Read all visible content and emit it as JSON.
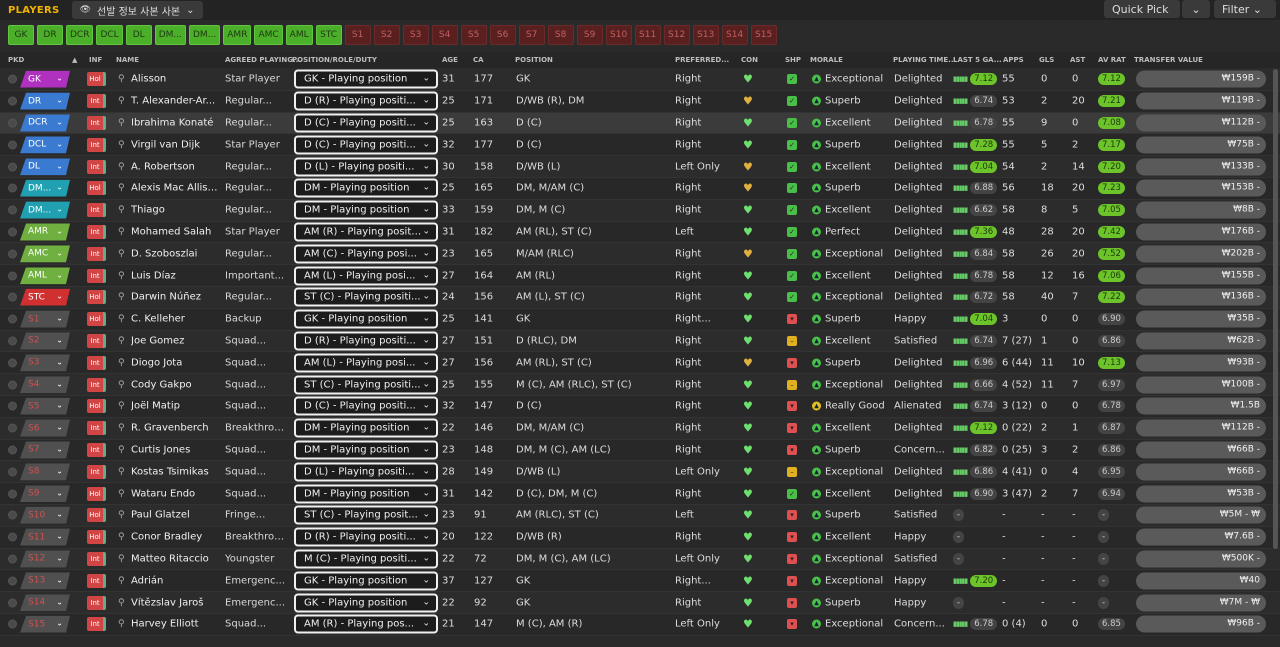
{
  "app": {
    "title": "PLAYERS",
    "view": "선발 정보 사본 사본",
    "quick_pick": "Quick Pick",
    "filter": "Filter"
  },
  "position_chips": {
    "filled": [
      "GK",
      "DR",
      "DCR",
      "DCL",
      "DL",
      "DM...",
      "DM...",
      "AMR",
      "AMC",
      "AML",
      "STC"
    ],
    "empty": [
      "S1",
      "S2",
      "S3",
      "S4",
      "S5",
      "S6",
      "S7",
      "S8",
      "S9",
      "S10",
      "S11",
      "S12",
      "S13",
      "S14",
      "S15"
    ]
  },
  "columns": {
    "pkd": "PKD",
    "sort": "▲",
    "inf": "INF",
    "name": "NAME",
    "status": "AGREED PLAYING...",
    "role": "POSITION/ROLE/DUTY",
    "age": "AGE",
    "ca": "CA",
    "position": "POSITION",
    "foot": "PREFERRED...",
    "con": "CON",
    "shp": "SHP",
    "morale": "MORALE",
    "ptime": "PLAYING TIME...",
    "last5": "LAST 5 GA...",
    "apps": "APPS",
    "gls": "GLS",
    "ast": "AST",
    "avrat": "AV RAT",
    "value": "TRANSFER VALUE"
  },
  "colors": {
    "accent": "#f0b400",
    "chip_green": "#4caf2a",
    "inf_red": "#d24545",
    "rating_green": "#6cc32a"
  },
  "players": [
    {
      "slot": "GK",
      "slot_color": "#b030c0",
      "inf": "Hol",
      "name": "Alisson",
      "status": "Star Player",
      "role": "GK - Playing position",
      "age": "31",
      "ca": "177",
      "pos": "GK",
      "foot": "Right",
      "con": "heart",
      "shp": "g",
      "morale": "Exceptional",
      "ptime": "Delighted",
      "last5": "7.12",
      "last5hi": true,
      "apps": "55",
      "gls": "0",
      "ast": "0",
      "avrat": "7.12",
      "avhi": true,
      "value": "₩159B - "
    },
    {
      "slot": "DR",
      "slot_color": "#3a7ad0",
      "inf": "Int",
      "name": "T. Alexander-Ar...",
      "status": "Regular...",
      "role": "D (R) - Playing positi...",
      "age": "25",
      "ca": "171",
      "pos": "D/WB (R), DM",
      "foot": "Right",
      "con": "gold",
      "shp": "g",
      "morale": "Superb",
      "ptime": "Delighted",
      "last5": "6.74",
      "last5hi": false,
      "apps": "53",
      "gls": "2",
      "ast": "20",
      "avrat": "7.21",
      "avhi": true,
      "value": "₩119B - "
    },
    {
      "slot": "DCR",
      "slot_color": "#3a7ad0",
      "inf": "Int",
      "name": "Ibrahima Konaté",
      "status": "Regular...",
      "role": "D (C) - Playing positi...",
      "age": "25",
      "ca": "163",
      "pos": "D (C)",
      "foot": "Right",
      "con": "heart",
      "shp": "g",
      "morale": "Excellent",
      "ptime": "Delighted",
      "last5": "6.78",
      "last5hi": false,
      "apps": "55",
      "gls": "9",
      "ast": "0",
      "avrat": "7.08",
      "avhi": true,
      "value": "₩112B - "
    },
    {
      "slot": "DCL",
      "slot_color": "#3a7ad0",
      "inf": "Int",
      "name": "Virgil van Dijk",
      "status": "Star Player",
      "role": "D (C) - Playing positi...",
      "age": "32",
      "ca": "177",
      "pos": "D (C)",
      "foot": "Right",
      "con": "heart",
      "shp": "g",
      "morale": "Superb",
      "ptime": "Delighted",
      "last5": "7.28",
      "last5hi": true,
      "apps": "55",
      "gls": "5",
      "ast": "2",
      "avrat": "7.17",
      "avhi": true,
      "value": "₩75B - "
    },
    {
      "slot": "DL",
      "slot_color": "#3a7ad0",
      "inf": "Int",
      "name": "A. Robertson",
      "status": "Regular...",
      "role": "D (L) - Playing positi...",
      "age": "30",
      "ca": "158",
      "pos": "D/WB (L)",
      "foot": "Left Only",
      "con": "gold",
      "shp": "g",
      "morale": "Excellent",
      "ptime": "Delighted",
      "last5": "7.04",
      "last5hi": true,
      "apps": "54",
      "gls": "2",
      "ast": "14",
      "avrat": "7.20",
      "avhi": true,
      "value": "₩133B - "
    },
    {
      "slot": "DM...",
      "slot_color": "#20a0b0",
      "inf": "Hol",
      "name": "Alexis Mac Allister",
      "status": "Regular...",
      "role": "DM - Playing position",
      "age": "25",
      "ca": "165",
      "pos": "DM, M/AM (C)",
      "foot": "Right",
      "con": "gold",
      "shp": "g",
      "morale": "Superb",
      "ptime": "Delighted",
      "last5": "6.88",
      "last5hi": false,
      "apps": "56",
      "gls": "18",
      "ast": "20",
      "avrat": "7.23",
      "avhi": true,
      "value": "₩153B - "
    },
    {
      "slot": "DM...",
      "slot_color": "#20a0b0",
      "inf": "Int",
      "name": "Thiago",
      "status": "Regular...",
      "role": "DM - Playing position",
      "age": "33",
      "ca": "159",
      "pos": "DM, M (C)",
      "foot": "Right",
      "con": "heart",
      "shp": "g",
      "morale": "Excellent",
      "ptime": "Delighted",
      "last5": "6.62",
      "last5hi": false,
      "apps": "58",
      "gls": "8",
      "ast": "5",
      "avrat": "7.05",
      "avhi": true,
      "value": "₩8B - "
    },
    {
      "slot": "AMR",
      "slot_color": "#70b040",
      "inf": "Int",
      "name": "Mohamed Salah",
      "status": "Star Player",
      "role": "AM (R) - Playing positi...",
      "age": "31",
      "ca": "182",
      "pos": "AM (RL), ST (C)",
      "foot": "Left",
      "con": "heart",
      "shp": "g",
      "morale": "Perfect",
      "ptime": "Delighted",
      "last5": "7.36",
      "last5hi": true,
      "apps": "48",
      "gls": "28",
      "ast": "20",
      "avrat": "7.42",
      "avhi": true,
      "value": "₩176B - "
    },
    {
      "slot": "AMC",
      "slot_color": "#70b040",
      "inf": "Int",
      "name": "D. Szoboszlai",
      "status": "Regular...",
      "role": "AM (C) - Playing posi...",
      "age": "23",
      "ca": "165",
      "pos": "M/AM (RLC)",
      "foot": "Right",
      "con": "gold",
      "shp": "g",
      "morale": "Exceptional",
      "ptime": "Delighted",
      "last5": "6.84",
      "last5hi": false,
      "apps": "58",
      "gls": "26",
      "ast": "20",
      "avrat": "7.52",
      "avhi": true,
      "value": "₩202B - "
    },
    {
      "slot": "AML",
      "slot_color": "#70b040",
      "inf": "Int",
      "name": "Luis Díaz",
      "status": "Important...",
      "role": "AM (L) - Playing posi...",
      "age": "27",
      "ca": "164",
      "pos": "AM (RL)",
      "foot": "Right",
      "con": "heart",
      "shp": "g",
      "morale": "Excellent",
      "ptime": "Delighted",
      "last5": "6.78",
      "last5hi": false,
      "apps": "58",
      "gls": "12",
      "ast": "16",
      "avrat": "7.06",
      "avhi": true,
      "value": "₩155B - "
    },
    {
      "slot": "STC",
      "slot_color": "#d03030",
      "inf": "Hol",
      "name": "Darwin Núñez",
      "status": "Regular...",
      "role": "ST (C) - Playing positi...",
      "age": "24",
      "ca": "156",
      "pos": "AM (L), ST (C)",
      "foot": "Right",
      "con": "heart",
      "shp": "g",
      "morale": "Exceptional",
      "ptime": "Delighted",
      "last5": "6.72",
      "last5hi": false,
      "apps": "58",
      "gls": "40",
      "ast": "7",
      "avrat": "7.22",
      "avhi": true,
      "value": "₩136B - "
    },
    {
      "slot": "S1",
      "slot_color": "res",
      "inf": "Hol",
      "name": "C. Kelleher",
      "status": "Backup",
      "role": "GK - Playing position",
      "age": "25",
      "ca": "141",
      "pos": "GK",
      "foot": "Right...",
      "con": "heart",
      "shp": "r",
      "morale": "Superb",
      "ptime": "Happy",
      "last5": "7.04",
      "last5hi": true,
      "apps": "3",
      "gls": "0",
      "ast": "0",
      "avrat": "6.90",
      "avhi": false,
      "value": "₩35B - "
    },
    {
      "slot": "S2",
      "slot_color": "res",
      "inf": "Int",
      "name": "Joe Gomez",
      "status": "Squad...",
      "role": "D (R) - Playing positi...",
      "age": "27",
      "ca": "151",
      "pos": "D (RLC), DM",
      "foot": "Right",
      "con": "heart",
      "shp": "y",
      "morale": "Excellent",
      "ptime": "Satisfied",
      "last5": "6.74",
      "last5hi": false,
      "apps": "7 (27)",
      "gls": "1",
      "ast": "0",
      "avrat": "6.86",
      "avhi": false,
      "value": "₩62B - "
    },
    {
      "slot": "S3",
      "slot_color": "res",
      "inf": "Int",
      "name": "Diogo Jota",
      "status": "Squad...",
      "role": "AM (L) - Playing posi...",
      "age": "27",
      "ca": "156",
      "pos": "AM (RL), ST (C)",
      "foot": "Right",
      "con": "gold",
      "shp": "r",
      "morale": "Superb",
      "ptime": "Delighted",
      "last5": "6.96",
      "last5hi": false,
      "apps": "6 (44)",
      "gls": "11",
      "ast": "10",
      "avrat": "7.13",
      "avhi": true,
      "value": "₩93B - "
    },
    {
      "slot": "S4",
      "slot_color": "res",
      "inf": "Int",
      "name": "Cody Gakpo",
      "status": "Squad...",
      "role": "ST (C) - Playing positi...",
      "age": "25",
      "ca": "155",
      "pos": "M (C), AM (RLC), ST (C)",
      "foot": "Right",
      "con": "heart",
      "shp": "y",
      "morale": "Exceptional",
      "ptime": "Delighted",
      "last5": "6.66",
      "last5hi": false,
      "apps": "4 (52)",
      "gls": "11",
      "ast": "7",
      "avrat": "6.97",
      "avhi": false,
      "value": "₩100B - "
    },
    {
      "slot": "S5",
      "slot_color": "res",
      "inf": "Hol",
      "name": "Joël Matip",
      "status": "Squad...",
      "role": "D (C) - Playing positi...",
      "age": "32",
      "ca": "147",
      "pos": "D (C)",
      "foot": "Right",
      "con": "heart",
      "shp": "r",
      "morale": "Really Good",
      "ptime": "Alienated",
      "last5": "6.74",
      "last5hi": false,
      "apps": "3 (12)",
      "gls": "0",
      "ast": "0",
      "avrat": "6.78",
      "avhi": false,
      "value": "₩1.5B"
    },
    {
      "slot": "S6",
      "slot_color": "res",
      "inf": "Int",
      "name": "R. Gravenberch",
      "status": "Breakthrou...",
      "role": "DM - Playing position",
      "age": "22",
      "ca": "146",
      "pos": "DM, M/AM (C)",
      "foot": "Right",
      "con": "heart",
      "shp": "r",
      "morale": "Excellent",
      "ptime": "Delighted",
      "last5": "7.12",
      "last5hi": true,
      "apps": "0 (22)",
      "gls": "2",
      "ast": "1",
      "avrat": "6.87",
      "avhi": false,
      "value": "₩112B - "
    },
    {
      "slot": "S7",
      "slot_color": "res",
      "inf": "Int",
      "name": "Curtis Jones",
      "status": "Squad...",
      "role": "DM - Playing position",
      "age": "23",
      "ca": "148",
      "pos": "DM, M (C), AM (LC)",
      "foot": "Right",
      "con": "heart",
      "shp": "r",
      "morale": "Superb",
      "ptime": "Concern...",
      "last5": "6.82",
      "last5hi": false,
      "apps": "0 (25)",
      "gls": "3",
      "ast": "2",
      "avrat": "6.86",
      "avhi": false,
      "value": "₩66B - "
    },
    {
      "slot": "S8",
      "slot_color": "res",
      "inf": "Int",
      "name": "Kostas Tsimikas",
      "status": "Squad...",
      "role": "D (L) - Playing positi...",
      "age": "28",
      "ca": "149",
      "pos": "D/WB (L)",
      "foot": "Left Only",
      "con": "heart",
      "shp": "y",
      "morale": "Exceptional",
      "ptime": "Delighted",
      "last5": "6.86",
      "last5hi": false,
      "apps": "4 (41)",
      "gls": "0",
      "ast": "4",
      "avrat": "6.95",
      "avhi": false,
      "value": "₩66B - "
    },
    {
      "slot": "S9",
      "slot_color": "res",
      "inf": "Hol",
      "name": "Wataru Endo",
      "status": "Squad...",
      "role": "DM - Playing position",
      "age": "31",
      "ca": "142",
      "pos": "D (C), DM, M (C)",
      "foot": "Right",
      "con": "heart",
      "shp": "g",
      "morale": "Excellent",
      "ptime": "Delighted",
      "last5": "6.90",
      "last5hi": false,
      "apps": "3 (47)",
      "gls": "2",
      "ast": "7",
      "avrat": "6.94",
      "avhi": false,
      "value": "₩53B - "
    },
    {
      "slot": "S10",
      "slot_color": "res",
      "inf": "Hol",
      "name": "Paul Glatzel",
      "status": "Fringe...",
      "role": "ST (C) - Playing posit...",
      "age": "23",
      "ca": "91",
      "pos": "AM (RLC), ST (C)",
      "foot": "Left",
      "con": "heart",
      "shp": "r",
      "morale": "Superb",
      "ptime": "Satisfied",
      "last5": "-",
      "last5hi": false,
      "apps": "-",
      "gls": "-",
      "ast": "-",
      "avrat": "-",
      "avhi": false,
      "value": "₩5M - ₩"
    },
    {
      "slot": "S11",
      "slot_color": "res",
      "inf": "Hol",
      "name": "Conor Bradley",
      "status": "Breakthrou...",
      "role": "D (R) - Playing positi...",
      "age": "20",
      "ca": "122",
      "pos": "D/WB (R)",
      "foot": "Right",
      "con": "heart",
      "shp": "r",
      "morale": "Excellent",
      "ptime": "Happy",
      "last5": "-",
      "last5hi": false,
      "apps": "-",
      "gls": "-",
      "ast": "-",
      "avrat": "-",
      "avhi": false,
      "value": "₩7.6B - "
    },
    {
      "slot": "S12",
      "slot_color": "res",
      "inf": "Int",
      "name": "Matteo Ritaccio",
      "status": "Youngster",
      "role": "M (C) - Playing positi...",
      "age": "22",
      "ca": "72",
      "pos": "DM, M (C), AM (LC)",
      "foot": "Left Only",
      "con": "heart",
      "shp": "r",
      "morale": "Exceptional",
      "ptime": "Satisfied",
      "last5": "-",
      "last5hi": false,
      "apps": "-",
      "gls": "-",
      "ast": "-",
      "avrat": "-",
      "avhi": false,
      "value": "₩500K - "
    },
    {
      "slot": "S13",
      "slot_color": "res",
      "inf": "Int",
      "name": "Adrián",
      "status": "Emergenc...",
      "role": "GK - Playing position",
      "age": "37",
      "ca": "127",
      "pos": "GK",
      "foot": "Right...",
      "con": "heart",
      "shp": "r",
      "morale": "Exceptional",
      "ptime": "Happy",
      "last5": "7.20",
      "last5hi": true,
      "apps": "-",
      "gls": "-",
      "ast": "-",
      "avrat": "-",
      "avhi": false,
      "value": "₩40"
    },
    {
      "slot": "S14",
      "slot_color": "res",
      "inf": "Int",
      "name": "Vítězslav Jaroš",
      "status": "Emergenc...",
      "role": "GK - Playing position",
      "age": "22",
      "ca": "92",
      "pos": "GK",
      "foot": "Right",
      "con": "heart",
      "shp": "r",
      "morale": "Superb",
      "ptime": "Happy",
      "last5": "-",
      "last5hi": false,
      "apps": "-",
      "gls": "-",
      "ast": "-",
      "avrat": "-",
      "avhi": false,
      "value": "₩7M - ₩"
    },
    {
      "slot": "S15",
      "slot_color": "res",
      "inf": "Int",
      "name": "Harvey Elliott",
      "status": "Squad...",
      "role": "AM (R) - Playing pos...",
      "age": "21",
      "ca": "147",
      "pos": "M (C), AM (R)",
      "foot": "Left Only",
      "con": "heart",
      "shp": "r",
      "morale": "Exceptional",
      "ptime": "Concern...",
      "last5": "6.78",
      "last5hi": false,
      "apps": "0 (4)",
      "gls": "0",
      "ast": "0",
      "avrat": "6.85",
      "avhi": false,
      "value": "₩96B - "
    }
  ]
}
